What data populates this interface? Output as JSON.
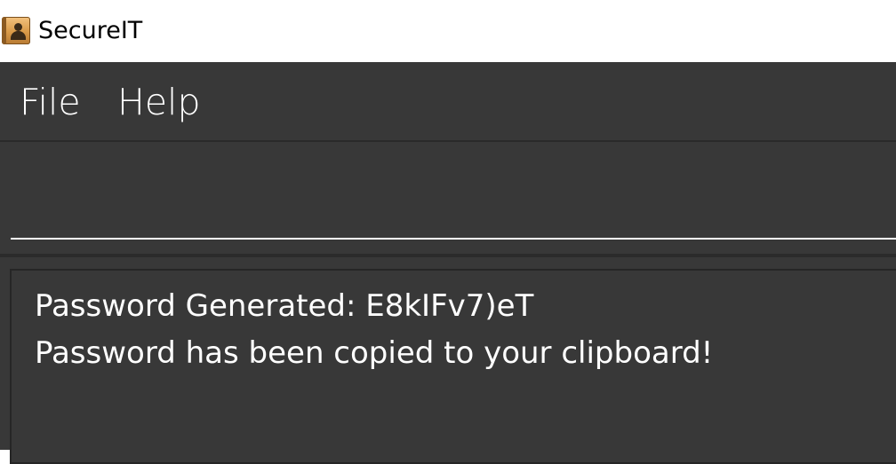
{
  "window": {
    "title": "SecureIT",
    "icon": "contacts-book-icon"
  },
  "menu": {
    "items": [
      {
        "label": "File"
      },
      {
        "label": "Help"
      }
    ]
  },
  "command_box": {
    "value": "",
    "placeholder": ""
  },
  "result": {
    "lines": [
      "Password Generated: E8kIFv7)eT",
      "Password has been copied to your clipboard!"
    ]
  },
  "colors": {
    "background": "#383838",
    "text": "#ffffff",
    "titlebar": "#ffffff"
  }
}
